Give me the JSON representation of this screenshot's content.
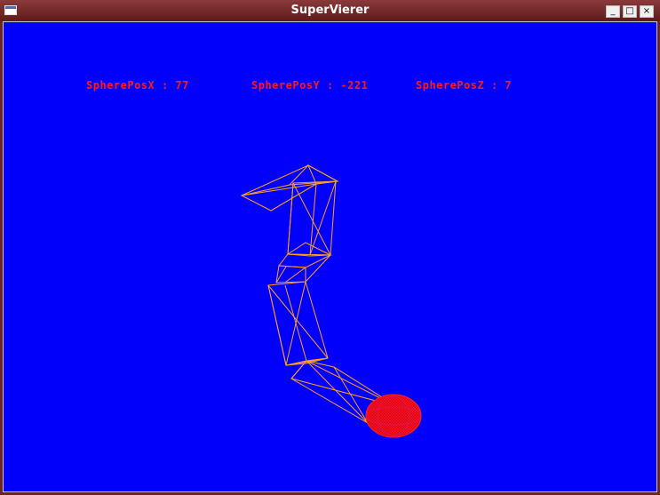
{
  "window": {
    "title": "SuperVierer",
    "controls": {
      "minimize_icon": "minimize-icon",
      "maximize_icon": "maximize-icon",
      "close_icon": "close-icon"
    }
  },
  "viewport": {
    "background_color": "#0000fb",
    "readouts": [
      {
        "label": "SpherePosX : 77"
      },
      {
        "label": "SpherePosY : -221"
      },
      {
        "label": "SpherePosZ : 7"
      }
    ],
    "readout_color": "#ff1a1a",
    "wireframe_color": "#ffa020",
    "sphere_color": "#ff1010"
  }
}
